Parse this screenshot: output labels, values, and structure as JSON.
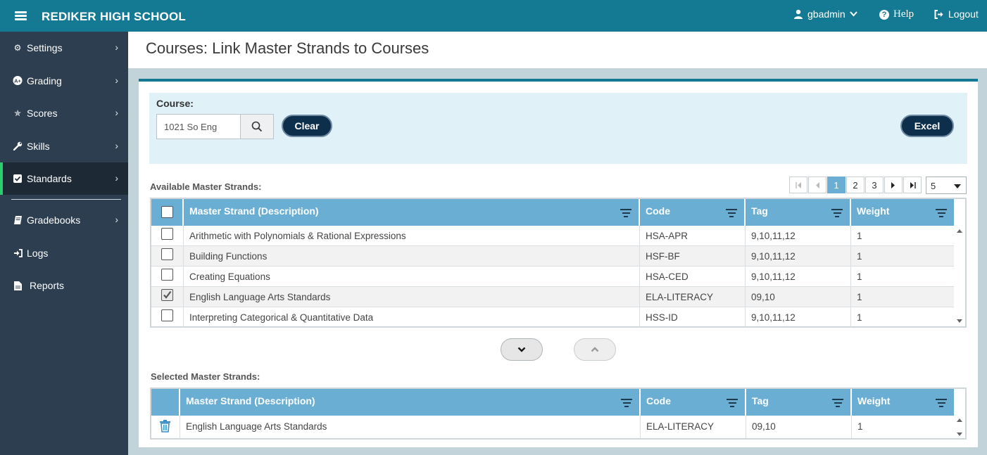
{
  "topbar": {
    "title": "REDIKER HIGH SCHOOL",
    "user": "gbadmin",
    "help": "Help",
    "logout": "Logout"
  },
  "sidebar": {
    "items": [
      {
        "label": "Settings",
        "icon": "gear-icon"
      },
      {
        "label": "Grading",
        "icon": "a-plus-icon"
      },
      {
        "label": "Scores",
        "icon": "star-icon"
      },
      {
        "label": "Skills",
        "icon": "wrench-icon"
      },
      {
        "label": "Standards",
        "icon": "checkbox-icon"
      },
      {
        "label": "Gradebooks",
        "icon": "book-icon"
      },
      {
        "label": "Logs",
        "icon": "sign-in-icon"
      },
      {
        "label": "Reports",
        "icon": "document-icon"
      }
    ],
    "active": "Standards"
  },
  "page": {
    "title": "Courses: Link Master Strands to Courses"
  },
  "filter": {
    "course_label": "Course:",
    "course_value": "1021 So Eng",
    "clear": "Clear",
    "excel": "Excel"
  },
  "available": {
    "label": "Available Master Strands:",
    "pager": {
      "pages": [
        "1",
        "2",
        "3"
      ],
      "current": "1",
      "page_size": "5"
    },
    "columns": [
      "Master Strand (Description)",
      "Code",
      "Tag",
      "Weight"
    ],
    "rows": [
      {
        "checked": false,
        "desc": "Arithmetic with Polynomials & Rational Expressions",
        "code": "HSA-APR",
        "tag": "9,10,11,12",
        "weight": "1"
      },
      {
        "checked": false,
        "desc": "Building Functions",
        "code": "HSF-BF",
        "tag": "9,10,11,12",
        "weight": "1"
      },
      {
        "checked": false,
        "desc": "Creating Equations",
        "code": "HSA-CED",
        "tag": "9,10,11,12",
        "weight": "1"
      },
      {
        "checked": true,
        "desc": "English Language Arts Standards",
        "code": "ELA-LITERACY",
        "tag": "09,10",
        "weight": "1"
      },
      {
        "checked": false,
        "desc": "Interpreting Categorical & Quantitative Data",
        "code": "HSS-ID",
        "tag": "9,10,11,12",
        "weight": "1"
      }
    ]
  },
  "selected": {
    "label": "Selected Master Strands:",
    "columns": [
      "Master Strand (Description)",
      "Code",
      "Tag",
      "Weight"
    ],
    "rows": [
      {
        "desc": "English Language Arts Standards",
        "code": "ELA-LITERACY",
        "tag": "09,10",
        "weight": "1"
      }
    ]
  },
  "colors": {
    "topbar": "#147a94",
    "sidebar": "#2c3e50",
    "header_cells": "#6aaed3",
    "active_accent": "#2ecc71",
    "dark_button": "#0e2f4c"
  }
}
